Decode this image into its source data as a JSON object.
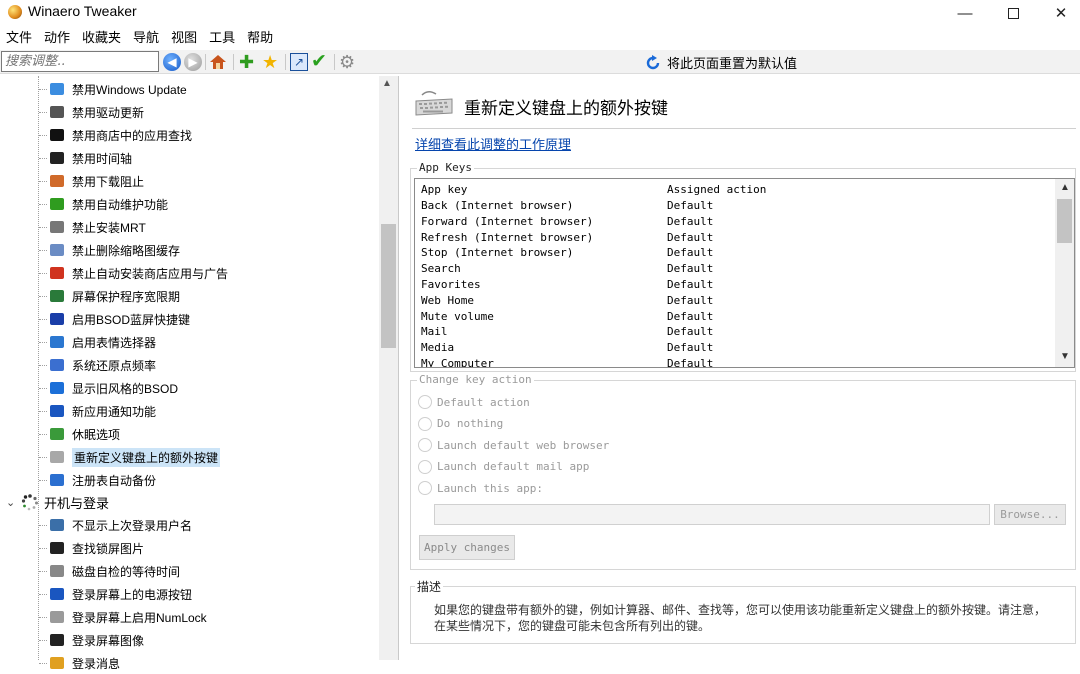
{
  "window": {
    "title": "Winaero Tweaker",
    "min": "—",
    "close": "✕"
  },
  "menu": [
    "文件",
    "动作",
    "收藏夹",
    "导航",
    "视图",
    "工具",
    "帮助"
  ],
  "toolbar": {
    "search_placeholder": "搜索调整..",
    "reset_label": "将此页面重置为默认值"
  },
  "tree": {
    "items": [
      {
        "label": "禁用Windows Update",
        "icon": "windows-update-icon",
        "color": "#3b8de0"
      },
      {
        "label": "禁用驱动更新",
        "icon": "driver-icon",
        "color": "#555555"
      },
      {
        "label": "禁用商店中的应用查找",
        "icon": "store-icon",
        "color": "#111111"
      },
      {
        "label": "禁用时间轴",
        "icon": "timeline-icon",
        "color": "#222222"
      },
      {
        "label": "禁用下载阻止",
        "icon": "download-icon",
        "color": "#d06a2a"
      },
      {
        "label": "禁用自动维护功能",
        "icon": "maintenance-icon",
        "color": "#2f9c1f"
      },
      {
        "label": "禁止安装MRT",
        "icon": "mrt-icon",
        "color": "#777777"
      },
      {
        "label": "禁止删除缩略图缓存",
        "icon": "thumbnail-cache-icon",
        "color": "#6b8cc4"
      },
      {
        "label": "禁止自动安装商店应用与广告",
        "icon": "no-ads-icon",
        "color": "#d0331f"
      },
      {
        "label": "屏幕保护程序宽限期",
        "icon": "screensaver-icon",
        "color": "#2a7a3a"
      },
      {
        "label": "启用BSOD蓝屏快捷键",
        "icon": "bsod-icon",
        "color": "#1a3ea8"
      },
      {
        "label": "启用表情选择器",
        "icon": "emoji-icon",
        "color": "#2b77d0"
      },
      {
        "label": "系统还原点频率",
        "icon": "restore-icon",
        "color": "#3b6fd0"
      },
      {
        "label": "显示旧风格的BSOD",
        "icon": "old-bsod-icon",
        "color": "#1b6fd8"
      },
      {
        "label": "新应用通知功能",
        "icon": "notification-icon",
        "color": "#1a56c0"
      },
      {
        "label": "休眠选项",
        "icon": "hibernate-icon",
        "color": "#3a9a3a"
      },
      {
        "label": "重新定义键盘上的额外按键",
        "icon": "keyboard-icon",
        "color": "#a8a8a8",
        "selected": true
      },
      {
        "label": "注册表自动备份",
        "icon": "registry-icon",
        "color": "#2b6fd0"
      }
    ],
    "group": {
      "label": "开机与登录",
      "chevron": "⌄"
    },
    "group_items": [
      {
        "label": "不显示上次登录用户名",
        "icon": "user-icon",
        "color": "#3b6fa8"
      },
      {
        "label": "查找锁屏图片",
        "icon": "lockscreen-image-icon",
        "color": "#222222"
      },
      {
        "label": "磁盘自检的等待时间",
        "icon": "disk-check-icon",
        "color": "#888888"
      },
      {
        "label": "登录屏幕上的电源按钮",
        "icon": "power-icon",
        "color": "#1a56c0"
      },
      {
        "label": "登录屏幕上启用NumLock",
        "icon": "numlock-icon",
        "color": "#9a9a9a"
      },
      {
        "label": "登录屏幕图像",
        "icon": "login-image-icon",
        "color": "#222222"
      },
      {
        "label": "登录消息",
        "icon": "login-message-icon",
        "color": "#e0a020"
      }
    ]
  },
  "page": {
    "title": "重新定义键盘上的额外按键",
    "how_link": "详细查看此调整的工作原理",
    "app_keys_label": "App Keys",
    "table": {
      "headers": [
        "App key",
        "Assigned action"
      ],
      "rows": [
        [
          "Back (Internet browser)",
          "Default"
        ],
        [
          "Forward (Internet browser)",
          "Default"
        ],
        [
          "Refresh (Internet browser)",
          "Default"
        ],
        [
          "Stop (Internet browser)",
          "Default"
        ],
        [
          "Search",
          "Default"
        ],
        [
          "Favorites",
          "Default"
        ],
        [
          "Web Home",
          "Default"
        ],
        [
          "Mute volume",
          "Default"
        ],
        [
          "Mail",
          "Default"
        ],
        [
          "Media",
          "Default"
        ],
        [
          "My Computer",
          "Default"
        ]
      ]
    },
    "change_label": "Change key action",
    "radios": [
      "Default action",
      "Do nothing",
      "Launch default web browser",
      "Launch default mail app",
      "Launch this app:"
    ],
    "browse_label": "Browse...",
    "apply_label": "Apply changes",
    "desc_label": "描述",
    "desc_text": "如果您的键盘带有额外的键，例如计算器、邮件、查找等，您可以使用该功能重新定义键盘上的额外按键。请注意，在某些情况下，您的键盘可能未包含所有列出的键。"
  }
}
